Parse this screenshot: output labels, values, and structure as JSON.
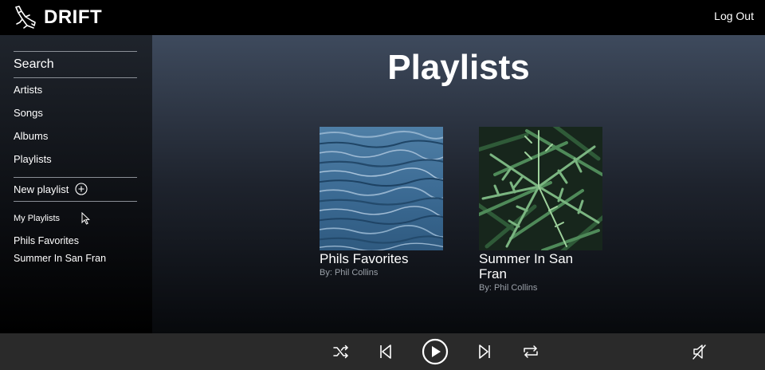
{
  "app": {
    "name": "DRIFT"
  },
  "header": {
    "logout_label": "Log Out"
  },
  "sidebar": {
    "search_label": "Search",
    "nav": [
      {
        "label": "Artists"
      },
      {
        "label": "Songs"
      },
      {
        "label": "Albums"
      },
      {
        "label": "Playlists"
      }
    ],
    "new_playlist_label": "New playlist",
    "my_playlists_heading": "My Playlists",
    "my_playlists": [
      {
        "label": "Phils Favorites"
      },
      {
        "label": "Summer In San Fran"
      }
    ]
  },
  "main": {
    "title": "Playlists",
    "cards": [
      {
        "title": "Phils Favorites",
        "owner": "By: Phil Collins",
        "cover": "ocean-water"
      },
      {
        "title": "Summer In San Fran",
        "owner": "By: Phil Collins",
        "cover": "fern-leaves"
      }
    ]
  },
  "player": {
    "controls": [
      "shuffle-icon",
      "previous-icon",
      "play-icon",
      "next-icon",
      "repeat-icon",
      "mute-icon"
    ]
  },
  "colors": {
    "topbar": "#000000",
    "player_bar": "#2a2a2a",
    "muted_text": "#9aa0a8"
  }
}
